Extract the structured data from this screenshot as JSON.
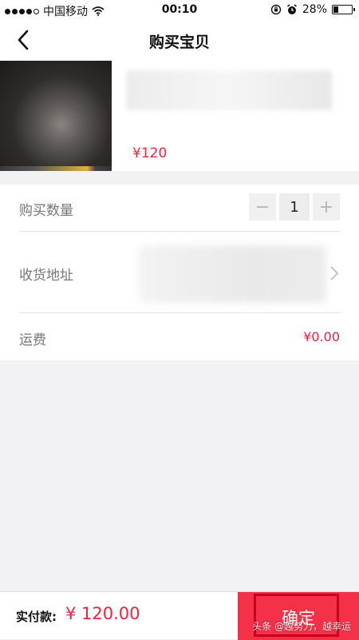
{
  "status_bar": {
    "carrier": "中国移动",
    "time": "00:10",
    "battery_percent": "28%",
    "battery_level": 0.28,
    "icons": [
      "signal-dots-icon",
      "wifi-icon",
      "orientation-lock-icon",
      "alarm-icon",
      "battery-icon"
    ]
  },
  "nav": {
    "title": "购买宝贝",
    "back_icon": "chevron-left-icon"
  },
  "product": {
    "price": "¥120"
  },
  "quantity": {
    "label": "购买数量",
    "minus": "−",
    "value": "1",
    "plus": "+"
  },
  "address": {
    "label": "收货地址",
    "chevron_icon": "chevron-right-icon"
  },
  "shipping": {
    "label": "运费",
    "value": "¥0.00"
  },
  "footer": {
    "pay_label": "实付款:",
    "pay_amount": "¥ 120.00",
    "confirm_label": "确定",
    "watermark": "头条 @越努力，越幸运"
  },
  "colors": {
    "accent": "#f0233e",
    "confirm_bg": "#f5314a",
    "highlight_border": "#c8001c",
    "background": "#f2f2f4"
  }
}
